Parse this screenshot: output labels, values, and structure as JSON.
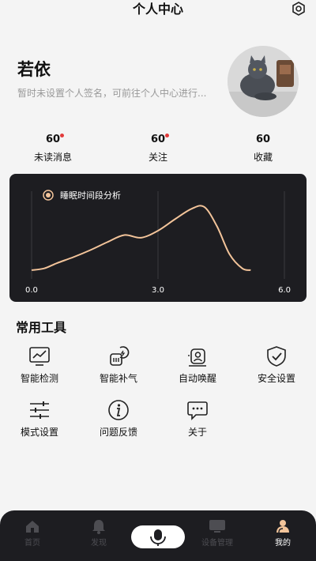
{
  "header": {
    "title": "个人中心",
    "settings_icon": "gear-icon"
  },
  "profile": {
    "username": "若依",
    "signature": "暂时未设置个人签名，可前往个人中心进行...",
    "avatar_icon": "cat-photo-avatar"
  },
  "stats": [
    {
      "value": "60",
      "label": "未读消息",
      "has_dot": true
    },
    {
      "value": "60",
      "label": "关注",
      "has_dot": true
    },
    {
      "value": "60",
      "label": "收藏",
      "has_dot": false
    }
  ],
  "chart_data": {
    "type": "line",
    "title": "睡眠时间段分析",
    "xlabel": "",
    "ylabel": "",
    "xlim": [
      0,
      6
    ],
    "ylim": [
      0,
      1
    ],
    "x_ticks": [
      "0.0",
      "3.0",
      "6.0"
    ],
    "grid": true,
    "series": [
      {
        "name": "",
        "color": "#f3c49a",
        "x": [
          0,
          0.3,
          0.6,
          1.0,
          1.4,
          1.8,
          2.2,
          2.6,
          3.0,
          3.4,
          3.8,
          4.1,
          4.4,
          4.7,
          5.0,
          5.2
        ],
        "y": [
          0.1,
          0.12,
          0.18,
          0.25,
          0.33,
          0.42,
          0.5,
          0.47,
          0.55,
          0.68,
          0.8,
          0.82,
          0.6,
          0.28,
          0.12,
          0.1
        ]
      }
    ]
  },
  "tools": {
    "title": "常用工具",
    "items": [
      {
        "label": "智能检测",
        "icon": "chart-monitor-icon"
      },
      {
        "label": "智能补气",
        "icon": "air-pump-icon"
      },
      {
        "label": "自动唤醒",
        "icon": "wake-alarm-icon"
      },
      {
        "label": "安全设置",
        "icon": "shield-check-icon"
      },
      {
        "label": "模式设置",
        "icon": "sliders-icon"
      },
      {
        "label": "问题反馈",
        "icon": "info-icon"
      },
      {
        "label": "关于",
        "icon": "chat-bubble-icon"
      }
    ]
  },
  "tabbar": {
    "items": [
      {
        "label": "首页",
        "icon": "home-icon",
        "active": false
      },
      {
        "label": "发现",
        "icon": "bell-icon",
        "active": false
      },
      {
        "label": "",
        "icon": "microphone-icon",
        "active": false
      },
      {
        "label": "设备管理",
        "icon": "device-icon",
        "active": false
      },
      {
        "label": "我的",
        "icon": "user-icon",
        "active": true
      }
    ]
  }
}
